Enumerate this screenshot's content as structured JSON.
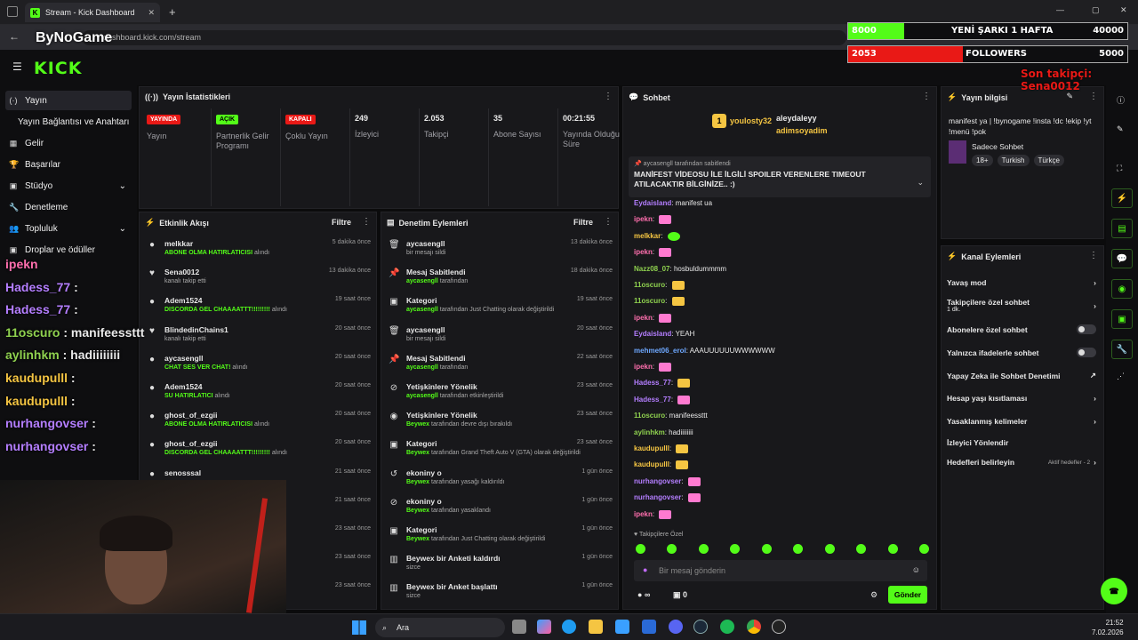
{
  "browser": {
    "tab_title": "Stream - Kick Dashboard",
    "url": "dashboard.kick.com/stream",
    "overlay_logo": "ByNoGame"
  },
  "app": {
    "logo": "KICK"
  },
  "sidebar": {
    "items": [
      {
        "label": "Yayın",
        "icon": "broadcast-icon"
      },
      {
        "label": "Yayın Bağlantısı ve Anahtarı",
        "icon": ""
      },
      {
        "label": "Gelir",
        "icon": "money-icon"
      },
      {
        "label": "Başarılar",
        "icon": "trophy-icon"
      },
      {
        "label": "Stüdyo",
        "icon": "studio-icon"
      },
      {
        "label": "Denetleme",
        "icon": "wrench-icon"
      },
      {
        "label": "Topluluk",
        "icon": "people-icon"
      },
      {
        "label": "Droplar ve ödüller",
        "icon": "gift-icon"
      }
    ]
  },
  "stats": {
    "title": "Yayın İstatistikleri",
    "items": [
      {
        "badge": "YAYINDA",
        "label": "Yayın",
        "color": "#e91916"
      },
      {
        "badge": "AÇIK",
        "label": "Partnerlik Gelir Programı",
        "color": "#53fc18"
      },
      {
        "badge": "KAPALI",
        "label": "Çoklu Yayın",
        "color": "#e91916"
      },
      {
        "value": "249",
        "label": "İzleyici"
      },
      {
        "value": "2.053",
        "label": "Takipçi"
      },
      {
        "value": "35",
        "label": "Abone Sayısı"
      },
      {
        "value": "00:21:55",
        "label": "Yayında Olduğu Süre"
      }
    ]
  },
  "activity": {
    "title": "Etkinlik Akışı",
    "filter": "Filtre",
    "rows": [
      {
        "name": "melkkar",
        "sub": "ABONE OLMA HATIRLATICISI",
        "suffix": "alındı",
        "time": "5 dakika önce",
        "icon": "●"
      },
      {
        "name": "Sena0012",
        "sub": "kanalı takip etti",
        "suffix": "",
        "time": "13 dakika önce",
        "icon": "♥"
      },
      {
        "name": "Adem1524",
        "sub": "DISCORDA GEL CHAAAATTT!!!!!!!!!",
        "suffix": "alındı",
        "time": "19 saat önce",
        "icon": "●"
      },
      {
        "name": "BlindedinChains1",
        "sub": "kanalı takip etti",
        "suffix": "",
        "time": "20 saat önce",
        "icon": "♥"
      },
      {
        "name": "aycasengll",
        "sub": "CHAT SES VER CHAT!",
        "suffix": "alındı",
        "time": "20 saat önce",
        "icon": "●"
      },
      {
        "name": "Adem1524",
        "sub": "SU HATIRLATICI",
        "suffix": "alındı",
        "time": "20 saat önce",
        "icon": "●"
      },
      {
        "name": "ghost_of_ezgii",
        "sub": "ABONE OLMA HATIRLATICISI",
        "suffix": "alındı",
        "time": "20 saat önce",
        "icon": "●"
      },
      {
        "name": "ghost_of_ezgii",
        "sub": "DISCORDA GEL CHAAAATTT!!!!!!!!!",
        "suffix": "alındı",
        "time": "20 saat önce",
        "icon": "●"
      },
      {
        "name": "senosssal",
        "sub": "",
        "suffix": "",
        "time": "21 saat önce",
        "icon": "●"
      },
      {
        "name": "",
        "sub": "",
        "suffix": "",
        "time": "21 saat önce",
        "icon": ""
      },
      {
        "name": "",
        "sub": "",
        "suffix": "",
        "time": "23 saat önce",
        "icon": ""
      },
      {
        "name": "",
        "sub": "",
        "suffix": "",
        "time": "23 saat önce",
        "icon": ""
      },
      {
        "name": "",
        "sub": "",
        "suffix": "",
        "time": "23 saat önce",
        "icon": ""
      }
    ]
  },
  "moderation": {
    "title": "Denetim Eylemleri",
    "filter": "Filtre",
    "rows": [
      {
        "name": "aycasengll",
        "pre": "",
        "sub": "bir mesajı sildi",
        "time": "13 dakika önce",
        "icon": "🗑"
      },
      {
        "name": "Mesaj Sabitlendi",
        "pre": "aycasengll",
        "sub": "tarafından",
        "time": "18 dakika önce",
        "icon": "📌"
      },
      {
        "name": "Kategori",
        "pre": "aycasengll",
        "sub": "tarafından Just Chatting olarak değiştirildi",
        "time": "19 saat önce",
        "icon": "▣"
      },
      {
        "name": "aycasengll",
        "pre": "",
        "sub": "bir mesajı sildi",
        "time": "20 saat önce",
        "icon": "🗑"
      },
      {
        "name": "Mesaj Sabitlendi",
        "pre": "aycasengll",
        "sub": "tarafından",
        "time": "22 saat önce",
        "icon": "📌"
      },
      {
        "name": "Yetişkinlere Yönelik",
        "pre": "aycasengll",
        "sub": "tarafından etkinleştirildi",
        "time": "23 saat önce",
        "icon": "⊘"
      },
      {
        "name": "Yetişkinlere Yönelik",
        "pre": "Beywex",
        "sub": "tarafından devre dışı bırakıldı",
        "time": "23 saat önce",
        "icon": "◉"
      },
      {
        "name": "Kategori",
        "pre": "Beywex",
        "sub": "tarafından Grand Theft Auto V (GTA) olarak değiştirildi",
        "time": "23 saat önce",
        "icon": "▣"
      },
      {
        "name": "ekoniny o",
        "pre": "Beywex",
        "sub": "tarafından yasağı kaldırıldı",
        "time": "1 gün önce",
        "icon": "↺"
      },
      {
        "name": "ekoniny o",
        "pre": "Beywex",
        "sub": "tarafından yasaklandı",
        "time": "1 gün önce",
        "icon": "⊘"
      },
      {
        "name": "Kategori",
        "pre": "Beywex",
        "sub": "tarafından Just Chatting olarak değiştirildi",
        "time": "1 gün önce",
        "icon": "▣"
      },
      {
        "name": "Beywex bir Anketi kaldırdı",
        "pre": "",
        "sub": "sizce",
        "time": "1 gün önce",
        "icon": "▥"
      },
      {
        "name": "Beywex bir Anket başlattı",
        "pre": "",
        "sub": "sizce",
        "time": "1 gün önce",
        "icon": "▥"
      }
    ]
  },
  "chat": {
    "title": "Sohbet",
    "top_users": [
      {
        "name": "youlosty32",
        "count": "1"
      },
      {
        "name": "aleydaleyy",
        "count": "1"
      },
      {
        "name": "adimsoyadim",
        "count": "1"
      }
    ],
    "pinned_by": "aycasengll tarafından sabitlendi",
    "pinned_text": "MANİFEST VİDEOSU İLE İLGİLİ SPOILER VERENLERE TIMEOUT ATILACAKTIR BİLGİNİZE.. :)",
    "messages": [
      {
        "user": "Eydaisland",
        "text": "manifest ua",
        "cls": "u-purple"
      },
      {
        "user": "ipekn",
        "text": "",
        "cls": "u-pink",
        "emote": "p"
      },
      {
        "user": "melkkar",
        "text": "",
        "cls": "u-yellow",
        "emote": "g"
      },
      {
        "user": "ipekn",
        "text": "",
        "cls": "u-pink",
        "emote": "p"
      },
      {
        "user": "Nazz08_07",
        "text": "hosbuldummmm",
        "cls": "u-green"
      },
      {
        "user": "11oscuro",
        "text": "",
        "cls": "u-green",
        "emote": "y"
      },
      {
        "user": "11oscuro",
        "text": "",
        "cls": "u-green",
        "emote": "y"
      },
      {
        "user": "ipekn",
        "text": "",
        "cls": "u-pink",
        "emote": "p"
      },
      {
        "user": "Eydaisland",
        "text": "YEAH",
        "cls": "u-purple"
      },
      {
        "user": "mehmet06_erol",
        "text": "AAAUUUUUUWWWWWW",
        "cls": "u-blue"
      },
      {
        "user": "ipekn",
        "text": "",
        "cls": "u-pink",
        "emote": "p"
      },
      {
        "user": "Hadess_77",
        "text": "",
        "cls": "u-purple",
        "emote": "y"
      },
      {
        "user": "Hadess_77",
        "text": "",
        "cls": "u-purple",
        "emote": "p"
      },
      {
        "user": "11oscuro",
        "text": "manifeessttt",
        "cls": "u-green"
      },
      {
        "user": "aylinhkm",
        "text": "hadiiiiiiii",
        "cls": "u-green"
      },
      {
        "user": "kaudupulll",
        "text": "",
        "cls": "u-yellow",
        "emote": "y"
      },
      {
        "user": "kaudupulll",
        "text": "",
        "cls": "u-yellow",
        "emote": "y"
      },
      {
        "user": "nurhangovser",
        "text": "",
        "cls": "u-purple",
        "emote": "p"
      },
      {
        "user": "nurhangovser",
        "text": "",
        "cls": "u-purple",
        "emote": "p"
      },
      {
        "user": "ipekn",
        "text": "",
        "cls": "u-pink",
        "emote": "p"
      }
    ],
    "followers_only": "Takipçilere Özel",
    "input_placeholder": "Bir mesaj gönderin",
    "send_label": "Gönder",
    "points": "∞",
    "gift_count": "0"
  },
  "stream_info": {
    "title": "Yayın bilgisi",
    "text": "manifest ya | !bynogame !insta !dc !ekip !yt !menü !pok",
    "category": "Sadece Sohbet",
    "tags": [
      "18+",
      "Turkish",
      "Türkçe"
    ]
  },
  "channel_actions": {
    "title": "Kanal Eylemleri",
    "rows": [
      {
        "label": "Yavaş mod",
        "type": "arrow"
      },
      {
        "label": "Takipçilere özel sohbet",
        "sub": "1 dk.",
        "type": "arrow"
      },
      {
        "label": "Abonelere özel sohbet",
        "type": "toggle"
      },
      {
        "label": "Yalnızca ifadelerle sohbet",
        "type": "toggle"
      },
      {
        "label": "Yapay Zeka ile Sohbet Denetimi",
        "type": "ext"
      },
      {
        "label": "Hesap yaşı kısıtlaması",
        "type": "arrow"
      },
      {
        "label": "Yasaklanmış kelimeler",
        "type": "arrow"
      },
      {
        "label": "İzleyici Yönlendir",
        "type": "none"
      },
      {
        "label": "Hedefleri belirleyin",
        "sub": "Aktif hedefler - 2",
        "type": "arrow"
      }
    ]
  },
  "overlay": {
    "bar1_left": "8000",
    "bar1_label": "YENİ ŞARKI 1 HAFTA",
    "bar1_right": "40000",
    "bar1_progress": 0.2,
    "bar2_left": "2053",
    "bar2_label": "FOLLOWERS",
    "bar2_right": "5000",
    "bar2_progress": 0.41,
    "last_follower": "Son takipçi: Sena0012",
    "chat": [
      {
        "user": "ipekn",
        "text": "",
        "cls": "u-pink"
      },
      {
        "user": "Hadess_77",
        "text": ":",
        "cls": "u-purple"
      },
      {
        "user": "Hadess_77",
        "text": ":",
        "cls": "u-purple"
      },
      {
        "user": "11oscuro",
        "text": ": manifeessttt",
        "cls": "u-green"
      },
      {
        "user": "aylinhkm",
        "text": ": hadiiiiiiii",
        "cls": "u-green"
      },
      {
        "user": "kaudupulll",
        "text": ":",
        "cls": "u-yellow"
      },
      {
        "user": "kaudupulll",
        "text": ":",
        "cls": "u-yellow"
      },
      {
        "user": "nurhangovser",
        "text": ":",
        "cls": "u-purple"
      },
      {
        "user": "nurhangovser",
        "text": ":",
        "cls": "u-purple"
      }
    ]
  },
  "taskbar": {
    "search": "Ara",
    "time": "21:52",
    "date": "7.02.2026"
  }
}
